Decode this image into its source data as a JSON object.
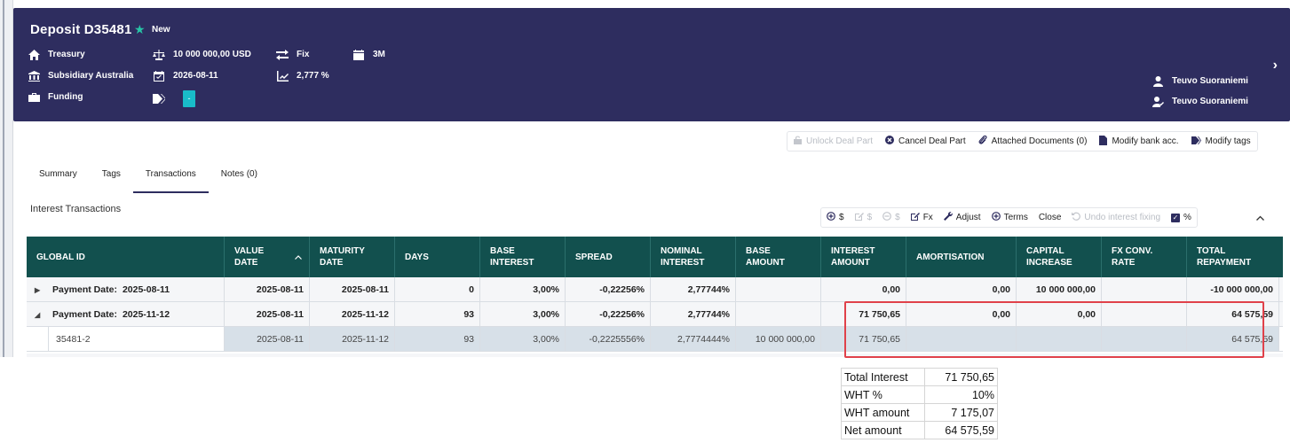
{
  "header": {
    "title": "Deposit D35481",
    "status": "New",
    "col1": [
      "Treasury",
      "Subsidiary Australia",
      "Funding"
    ],
    "amount": "10 000 000,00 USD",
    "date": "2026-08-11",
    "tag_chip": "-",
    "rate_type": "Fix",
    "rate": "2,777 %",
    "tenor": "3M",
    "users": [
      "Teuvo Suoraniemi",
      "Teuvo Suoraniemi"
    ]
  },
  "toolbar": {
    "unlock": "Unlock Deal Part",
    "cancel": "Cancel Deal Part",
    "attached": "Attached Documents (0)",
    "modify_bank": "Modify bank acc.",
    "modify_tags": "Modify tags"
  },
  "tabs": [
    "Summary",
    "Tags",
    "Transactions",
    "Notes (0)"
  ],
  "section_title": "Interest Transactions",
  "subtoolbar": {
    "add": "$",
    "edit": "$",
    "remove": "$",
    "fx": "Fx",
    "adjust": "Adjust",
    "terms": "Terms",
    "close": "Close",
    "undo": "Undo interest fixing",
    "percent": "%"
  },
  "table": {
    "headers": [
      [
        "GLOBAL ID"
      ],
      [
        "VALUE",
        "DATE"
      ],
      [
        "MATURITY",
        "DATE"
      ],
      [
        "DAYS"
      ],
      [
        "BASE",
        "INTEREST"
      ],
      [
        "SPREAD"
      ],
      [
        "NOMINAL",
        "INTEREST"
      ],
      [
        "BASE",
        "AMOUNT"
      ],
      [
        "INTEREST",
        "AMOUNT"
      ],
      [
        "AMORTISATION"
      ],
      [
        "CAPITAL",
        "INCREASE"
      ],
      [
        "FX CONV.",
        "RATE"
      ],
      [
        "TOTAL",
        "REPAYMENT"
      ]
    ],
    "groups": [
      {
        "label": "Payment Date:",
        "date": "2025-08-11",
        "cells": [
          "2025-08-11",
          "2025-08-11",
          "0",
          "3,00%",
          "-0,22256%",
          "2,77744%",
          "",
          "0,00",
          "0,00",
          "10 000 000,00",
          "",
          "-10 000 000,00"
        ]
      },
      {
        "label": "Payment Date:",
        "date": "2025-11-12",
        "cells": [
          "2025-08-11",
          "2025-11-12",
          "93",
          "3,00%",
          "-0,22256%",
          "2,77744%",
          "",
          "71 750,65",
          "0,00",
          "0,00",
          "",
          "64 575,59"
        ]
      }
    ],
    "detail": {
      "id": "35481-2",
      "cells": [
        "2025-08-11",
        "2025-11-12",
        "93",
        "3,00%",
        "-0,2225556%",
        "2,7774444%",
        "10 000 000,00",
        "71 750,65",
        "",
        "",
        "",
        "64 575,59"
      ]
    }
  },
  "calc": [
    {
      "label": "Total Interest",
      "value": "71 750,65"
    },
    {
      "label": "WHT %",
      "value": "10%"
    },
    {
      "label": "WHT amount",
      "value": "7 175,07"
    },
    {
      "label": "Net amount",
      "value": "64 575,59"
    }
  ]
}
